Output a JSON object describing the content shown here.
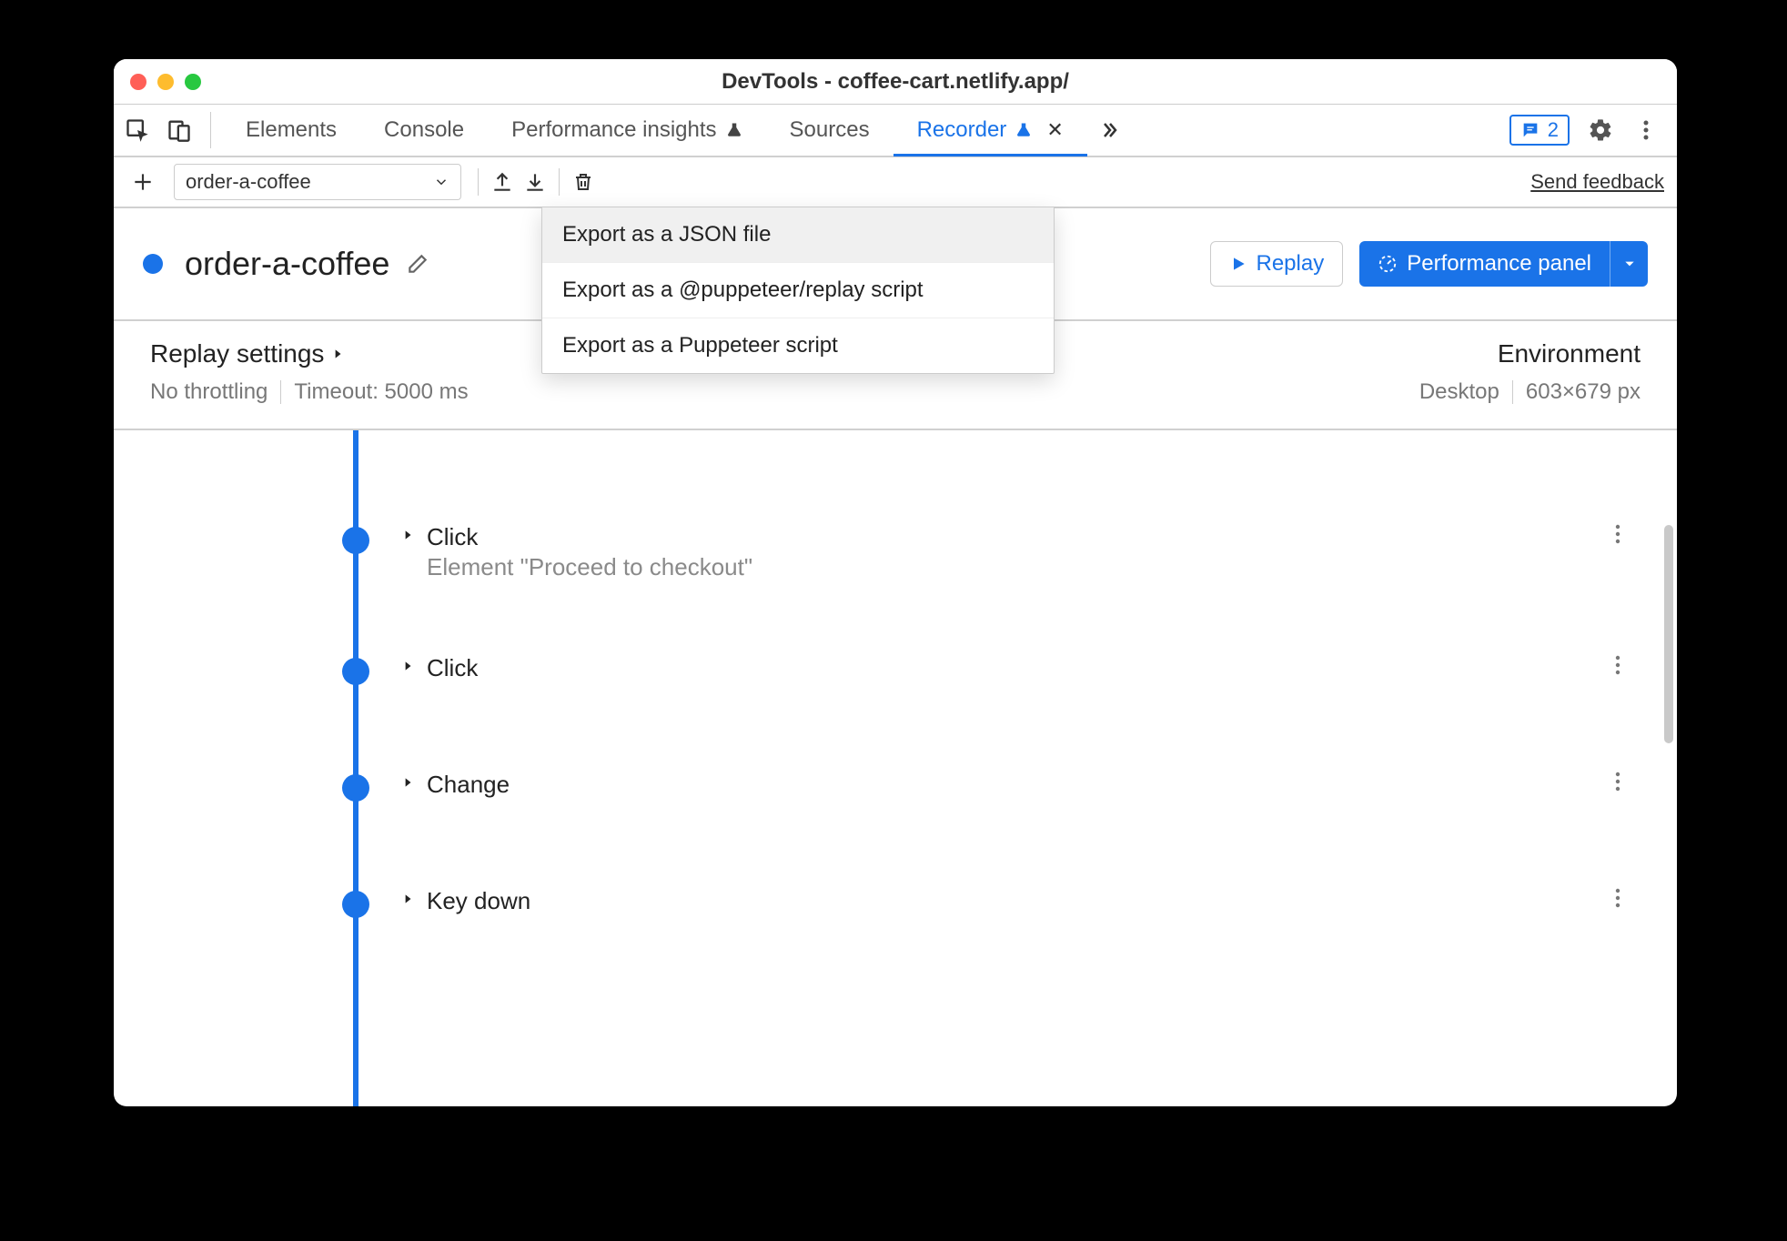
{
  "window": {
    "title": "DevTools - coffee-cart.netlify.app/"
  },
  "tabs": {
    "elements": "Elements",
    "console": "Console",
    "perf_insights": "Performance insights",
    "sources": "Sources",
    "recorder": "Recorder"
  },
  "issues_count": "2",
  "toolbar": {
    "recording_name": "order-a-coffee",
    "feedback": "Send feedback"
  },
  "header": {
    "title": "order-a-coffee",
    "replay": "Replay",
    "perf_panel": "Performance panel"
  },
  "export_menu": {
    "json": "Export as a JSON file",
    "replay_script": "Export as a @puppeteer/replay script",
    "puppeteer": "Export as a Puppeteer script"
  },
  "settings": {
    "replay_title": "Replay settings",
    "throttling": "No throttling",
    "timeout": "Timeout: 5000 ms",
    "env_title": "Environment",
    "device": "Desktop",
    "viewport": "603×679 px"
  },
  "steps": [
    {
      "label": "Click",
      "detail": "Element \"Proceed to checkout\""
    },
    {
      "label": "Click",
      "detail": ""
    },
    {
      "label": "Change",
      "detail": ""
    },
    {
      "label": "Key down",
      "detail": ""
    }
  ]
}
